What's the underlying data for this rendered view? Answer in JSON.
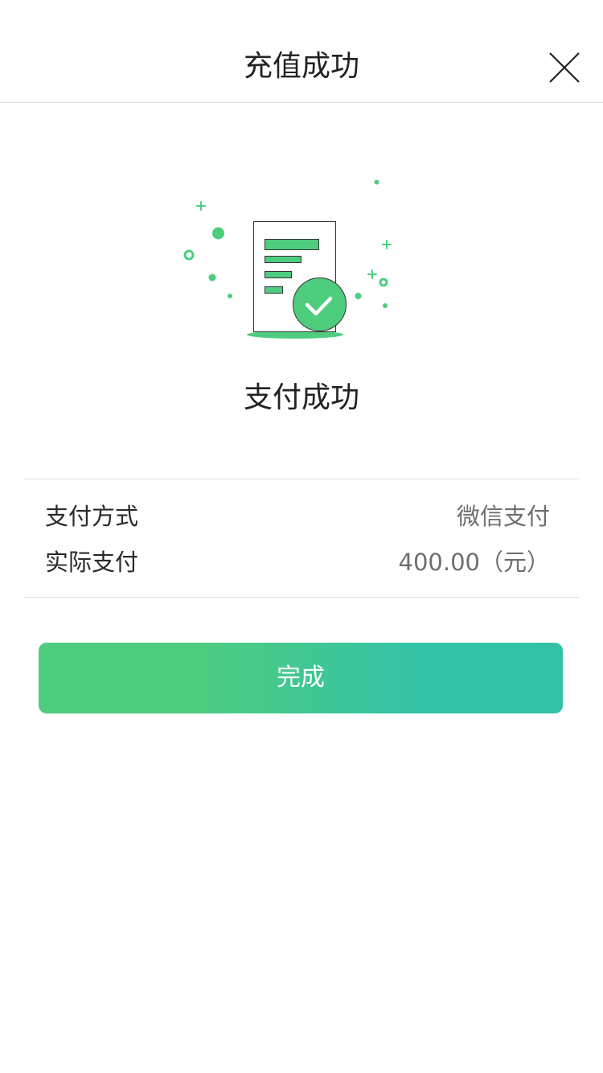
{
  "header": {
    "title": "充值成功",
    "close_icon": "close-icon"
  },
  "illustration": {
    "icon": "receipt-check-icon",
    "accent_color": "#4ecd7f"
  },
  "status": {
    "title": "支付成功"
  },
  "details": {
    "rows": [
      {
        "label": "支付方式",
        "value": "微信支付"
      },
      {
        "label": "实际支付",
        "value": "400.00（元）"
      }
    ]
  },
  "actions": {
    "done_label": "完成",
    "gradient_start": "#4ecd7f",
    "gradient_end": "#33c2a5"
  }
}
